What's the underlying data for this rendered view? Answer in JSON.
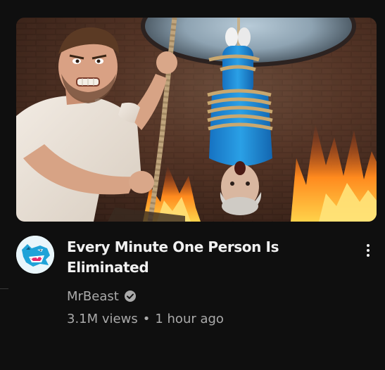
{
  "video": {
    "title": "Every Minute One Person Is Eliminated",
    "channel": "MrBeast",
    "views": "3.1M views",
    "separator": "•",
    "age": "1 hour ago",
    "verified": true
  },
  "icons": {
    "verified": "verified-check-icon",
    "more": "more-vertical-icon",
    "avatar": "mrbeast-panther-logo"
  },
  "colors": {
    "background": "#0f0f0f",
    "title": "#f1f1f1",
    "secondary_text": "#aaaaaa",
    "avatar_accent": "#1fa3d8"
  }
}
